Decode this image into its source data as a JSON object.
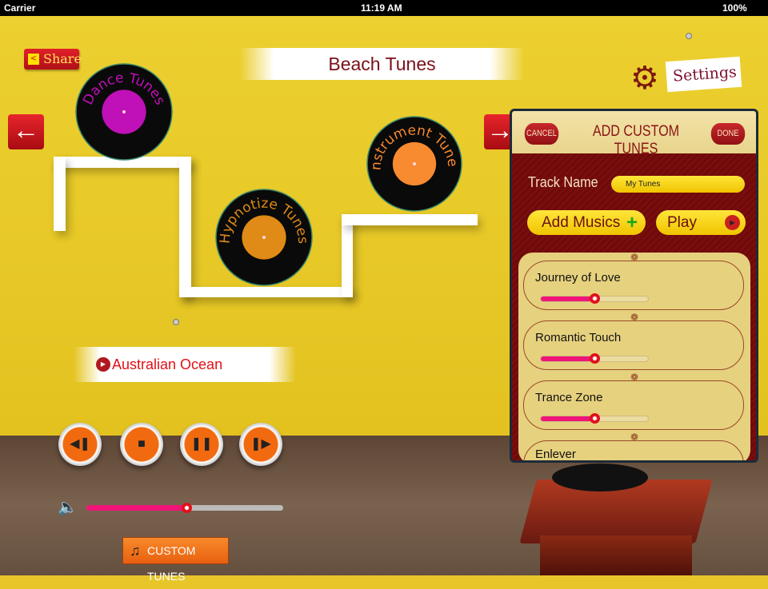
{
  "status": {
    "carrier": "Carrier",
    "time": "11:19 AM",
    "battery": "100%"
  },
  "header": {
    "share": "Share",
    "title": "Beach Tunes",
    "settings": "Settings"
  },
  "records": [
    {
      "label": "Dance Tunes",
      "color": "#c010b8"
    },
    {
      "label": "Hypnotize Tunes",
      "color": "#e08a18"
    },
    {
      "label": "Instrument Tunes",
      "color": "#f88a30"
    }
  ],
  "now_playing": "Australian Ocean",
  "volume": 0.51,
  "custom_button": "CUSTOM TUNES",
  "popover": {
    "cancel": "CANCEL",
    "title": "ADD CUSTOM TUNES",
    "done": "DONE",
    "track_label": "Track Name",
    "track_value": "My Tunes",
    "add_musics": "Add Musics",
    "play": "Play",
    "tracks": [
      {
        "name": "Journey of Love",
        "level": 0.5
      },
      {
        "name": "Romantic Touch",
        "level": 0.5
      },
      {
        "name": "Trance Zone",
        "level": 0.5
      },
      {
        "name": "Enlever"
      }
    ]
  }
}
